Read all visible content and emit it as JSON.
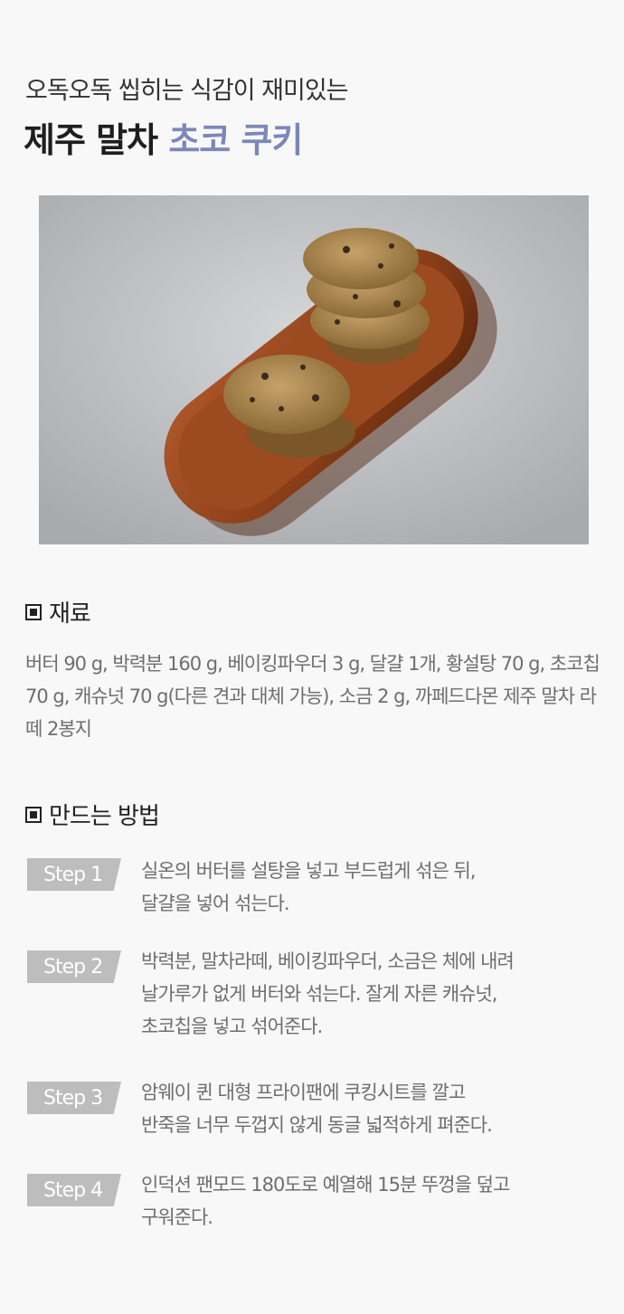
{
  "header": {
    "subtitle": "오독오독 씹히는 식감이 재미있는",
    "title_main": "제주 말차",
    "title_accent": "초코 쿠키"
  },
  "photo": {
    "description_icon": "cookie-plate-photo"
  },
  "ingredients": {
    "heading": "재료",
    "text": "버터 90 g, 박력분 160 g, 베이킹파우더 3 g, 달걀 1개, 황설탕 70 g, 초코칩 70 g, 캐슈넛 70 g(다른 견과 대체 가능), 소금 2 g, 까페드다몬 제주 말차 라떼 2봉지"
  },
  "method": {
    "heading": "만드는 방법",
    "steps": [
      {
        "label": "Step 1",
        "text": "실온의 버터를 설탕을 넣고 부드럽게 섞은 뒤,\n달걀을 넣어 섞는다."
      },
      {
        "label": "Step 2",
        "text": "박력분, 말차라떼, 베이킹파우더, 소금은 체에 내려\n날가루가 없게 버터와 섞는다. 잘게 자른 캐슈넛,\n초코칩을 넣고 섞어준다."
      },
      {
        "label": "Step 3",
        "text": "암웨이 퀸 대형 프라이팬에 쿠킹시트를 깔고\n반죽을 너무 두껍지 않게 동글 넓적하게 펴준다."
      },
      {
        "label": "Step 4",
        "text": "인덕션 팬모드 180도로 예열해 15분 뚜껑을 덮고\n구워준다."
      }
    ]
  },
  "colors": {
    "accent": "#7d87b8",
    "step_label_bg": "#bdbdbd",
    "body_text": "#6e6e6e"
  }
}
